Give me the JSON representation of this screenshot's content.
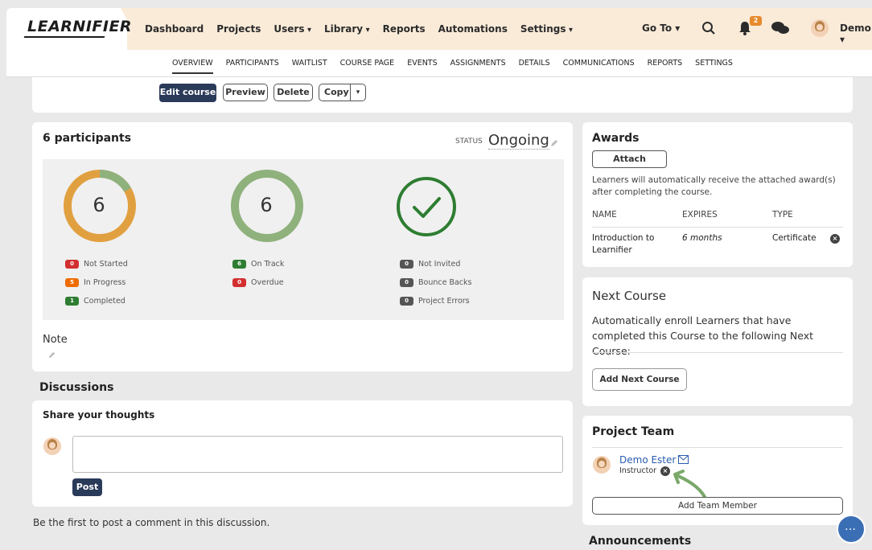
{
  "brand": {
    "logo_text": "LEARNIFIER"
  },
  "nav": {
    "items": [
      "Dashboard",
      "Projects",
      "Users",
      "Library",
      "Reports",
      "Automations",
      "Settings"
    ],
    "goto_label": "Go To",
    "notification_count": "2",
    "user_name": "Demo"
  },
  "subnav": {
    "items": [
      "OVERVIEW",
      "PARTICIPANTS",
      "WAITLIST",
      "COURSE PAGE",
      "EVENTS",
      "ASSIGNMENTS",
      "DETAILS",
      "COMMUNICATIONS",
      "REPORTS",
      "SETTINGS"
    ],
    "active": "OVERVIEW"
  },
  "course_actions": {
    "edit": "Edit course",
    "preview": "Preview",
    "delete": "Delete",
    "copy": "Copy"
  },
  "participants": {
    "title": "6 participants",
    "status_label": "STATUS",
    "status_value": "Ongoing",
    "ring1": {
      "value": "6",
      "not_started": "0",
      "in_progress": "5",
      "completed": "1",
      "not_started_label": "Not Started",
      "in_progress_label": "In Progress",
      "completed_label": "Completed"
    },
    "ring2": {
      "value": "6",
      "on_track": "6",
      "overdue": "0",
      "on_track_label": "On Track",
      "overdue_label": "Overdue"
    },
    "ring3": {
      "not_invited": "0",
      "bounce_backs": "0",
      "project_errors": "0",
      "not_invited_label": "Not Invited",
      "bounce_backs_label": "Bounce Backs",
      "project_errors_label": "Project Errors"
    },
    "note_label": "Note",
    "colors": {
      "orange": "#e1a040",
      "green": "#8fb17c",
      "dark_green": "#2e7d32",
      "red": "#d32f2f",
      "badge_orange": "#ef6c00",
      "grey": "#555555"
    }
  },
  "discussions": {
    "title": "Discussions",
    "share_label": "Share your thoughts",
    "post_button": "Post",
    "empty_text": "Be the first to post a comment in this discussion."
  },
  "awards": {
    "title": "Awards",
    "attach_button": "Attach",
    "description": "Learners will automatically receive the attached award(s) after completing the course.",
    "headers": [
      "NAME",
      "EXPIRES",
      "TYPE"
    ],
    "rows": [
      {
        "name": "Introduction to Learnifier",
        "expires": "6 months",
        "type": "Certificate"
      }
    ]
  },
  "next_course": {
    "title": "Next Course",
    "description": "Automatically enroll Learners that have completed this Course to the following Next Course:",
    "button": "Add Next Course"
  },
  "project_team": {
    "title": "Project Team",
    "members": [
      {
        "name": "Demo Ester",
        "role": "Instructor"
      }
    ],
    "add_button": "Add Team Member"
  },
  "announcements": {
    "title": "Announcements"
  }
}
